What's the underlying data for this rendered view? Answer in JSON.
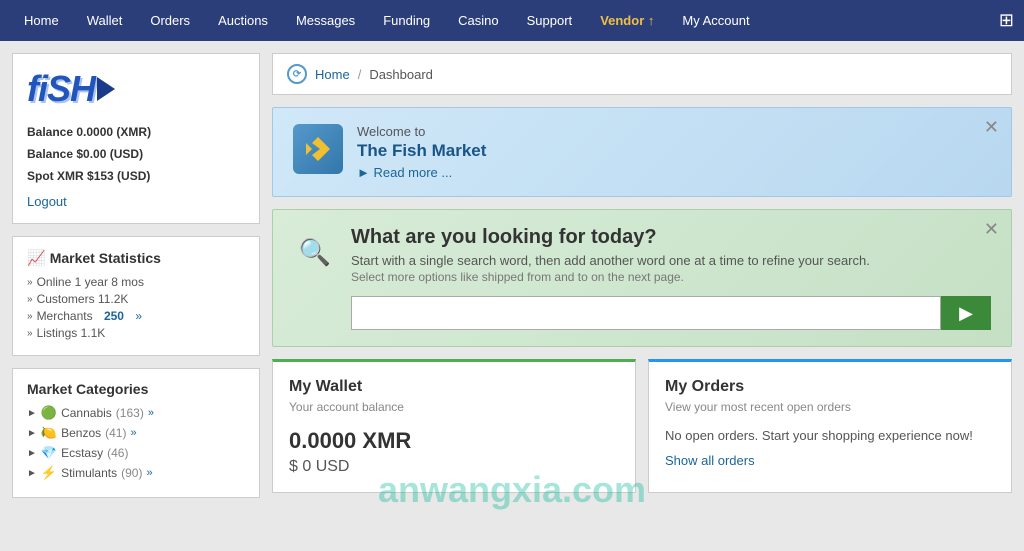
{
  "nav": {
    "items": [
      {
        "label": "Home",
        "active": false
      },
      {
        "label": "Wallet",
        "active": false
      },
      {
        "label": "Orders",
        "active": false
      },
      {
        "label": "Auctions",
        "active": false
      },
      {
        "label": "Messages",
        "active": false
      },
      {
        "label": "Funding",
        "active": false
      },
      {
        "label": "Casino",
        "active": false
      },
      {
        "label": "Support",
        "active": false
      },
      {
        "label": "Vendor ↑",
        "active": true,
        "vendor": true
      },
      {
        "label": "My Account",
        "active": false
      }
    ],
    "cart_icon": "🖤"
  },
  "sidebar": {
    "logo_text": "fiSH",
    "balance_xmr_label": "Balance",
    "balance_xmr_value": "0.0000 (XMR)",
    "balance_usd_label": "Balance",
    "balance_usd_value": "$0.00 (USD)",
    "spot_label": "Spot XMR",
    "spot_value": "$153 (USD)",
    "logout": "Logout",
    "stats": {
      "title": "Market Statistics",
      "online": "Online 1 year 8 mos",
      "customers": "Customers 11.2K",
      "merchants_label": "Merchants",
      "merchants_value": "250",
      "listings": "Listings 1.1K"
    },
    "categories": {
      "title": "Market Categories",
      "items": [
        {
          "emoji": "🟢",
          "name": "Cannabis",
          "count": "(163)"
        },
        {
          "emoji": "🍋",
          "name": "Benzos",
          "count": "(41)"
        },
        {
          "emoji": "💎",
          "name": "Ecstasy",
          "count": "(46)"
        },
        {
          "emoji": "⚡",
          "name": "Stimulants",
          "count": "(90)"
        }
      ]
    }
  },
  "breadcrumb": {
    "home": "Home",
    "separator": "/",
    "current": "Dashboard"
  },
  "welcome": {
    "pre": "Welcome to",
    "title": "The Fish Market",
    "readmore": "► Read more ..."
  },
  "search": {
    "title": "What are you looking for today?",
    "subtitle": "Start with a single search word, then add another word one at a time to refine your search.",
    "hint": "Select more options like shipped from and to on the next page.",
    "placeholder": "",
    "button_icon": "▶"
  },
  "wallet_card": {
    "title": "My Wallet",
    "subtitle": "Your account balance",
    "balance_xmr": "0.0000 XMR",
    "balance_usd": "$ 0 USD"
  },
  "orders_card": {
    "title": "My Orders",
    "subtitle": "View your most recent open orders",
    "empty_msg": "No open orders. Start your shopping experience now!",
    "show_all": "Show all orders"
  },
  "watermark": "anwangxia.com"
}
